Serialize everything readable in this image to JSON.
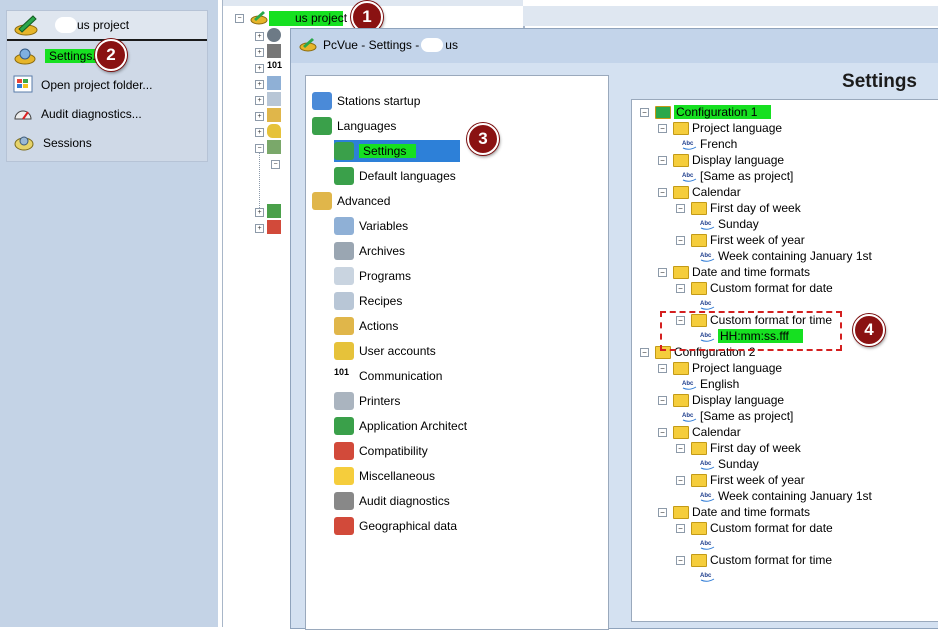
{
  "left_menu": {
    "title_prefix": "",
    "title_suffix": "us project",
    "items": [
      {
        "label": "Settings...",
        "icon": "settings-icon",
        "highlighted": true
      },
      {
        "label": "Open project folder...",
        "icon": "windows-folder-icon"
      },
      {
        "label": "Audit diagnostics...",
        "icon": "gauge-icon"
      },
      {
        "label": "Sessions",
        "icon": "sessions-icon"
      }
    ]
  },
  "project_tree": {
    "root_label": "us project"
  },
  "dialog": {
    "title_prefix": "PcVue - Settings - ",
    "title_suffix": "us",
    "nav": [
      {
        "label": "Stations startup",
        "icon": "stations-icon",
        "level": 0
      },
      {
        "label": "Languages",
        "icon": "languages-icon",
        "level": 0
      },
      {
        "label": "Settings",
        "icon": "globe-icon",
        "level": 1,
        "selected": true
      },
      {
        "label": "Default languages",
        "icon": "globe-icon",
        "level": 1
      },
      {
        "label": "Advanced",
        "icon": "advanced-icon",
        "level": 0
      },
      {
        "label": "Variables",
        "icon": "variables-icon",
        "level": 1
      },
      {
        "label": "Archives",
        "icon": "archives-icon",
        "level": 1
      },
      {
        "label": "Programs",
        "icon": "programs-icon",
        "level": 1
      },
      {
        "label": "Recipes",
        "icon": "recipes-icon",
        "level": 1
      },
      {
        "label": "Actions",
        "icon": "actions-icon",
        "level": 1
      },
      {
        "label": "User accounts",
        "icon": "key-icon",
        "level": 1
      },
      {
        "label": "Communication",
        "icon": "communication-icon",
        "level": 1
      },
      {
        "label": "Printers",
        "icon": "printer-icon",
        "level": 1
      },
      {
        "label": "Application Architect",
        "icon": "architect-icon",
        "level": 1
      },
      {
        "label": "Compatibility",
        "icon": "compatibility-icon",
        "level": 1
      },
      {
        "label": "Miscellaneous",
        "icon": "folder-icon",
        "level": 1
      },
      {
        "label": "Audit diagnostics",
        "icon": "gauge-icon",
        "level": 1
      },
      {
        "label": "Geographical data",
        "icon": "house-icon",
        "level": 1
      }
    ],
    "settings_title": "Settings",
    "tree": [
      {
        "label": "Configuration 1",
        "type": "root",
        "level": 0,
        "highlighted": true
      },
      {
        "label": "Project language",
        "type": "folder",
        "level": 1
      },
      {
        "label": "French",
        "type": "value",
        "level": 2
      },
      {
        "label": "Display language",
        "type": "folder",
        "level": 1
      },
      {
        "label": "[Same as project]",
        "type": "value",
        "level": 2
      },
      {
        "label": "Calendar",
        "type": "folder",
        "level": 1
      },
      {
        "label": "First day of week",
        "type": "folder",
        "level": 2
      },
      {
        "label": "Sunday",
        "type": "value",
        "level": 3
      },
      {
        "label": "First week of year",
        "type": "folder",
        "level": 2
      },
      {
        "label": "Week containing January 1st",
        "type": "value",
        "level": 3
      },
      {
        "label": "Date and time formats",
        "type": "folder",
        "level": 1
      },
      {
        "label": "Custom format for date",
        "type": "folder",
        "level": 2
      },
      {
        "label": "",
        "type": "value",
        "level": 3
      },
      {
        "label": "Custom format for time",
        "type": "folder",
        "level": 2
      },
      {
        "label": "HH:mm:ss.fff",
        "type": "value",
        "level": 3,
        "highlighted": true
      },
      {
        "label": "Configuration 2",
        "type": "root",
        "level": 0
      },
      {
        "label": "Project language",
        "type": "folder",
        "level": 1
      },
      {
        "label": "English",
        "type": "value",
        "level": 2
      },
      {
        "label": "Display language",
        "type": "folder",
        "level": 1
      },
      {
        "label": "[Same as project]",
        "type": "value",
        "level": 2
      },
      {
        "label": "Calendar",
        "type": "folder",
        "level": 1
      },
      {
        "label": "First day of week",
        "type": "folder",
        "level": 2
      },
      {
        "label": "Sunday",
        "type": "value",
        "level": 3
      },
      {
        "label": "First week of year",
        "type": "folder",
        "level": 2
      },
      {
        "label": "Week containing January 1st",
        "type": "value",
        "level": 3
      },
      {
        "label": "Date and time formats",
        "type": "folder",
        "level": 1
      },
      {
        "label": "Custom format for date",
        "type": "folder",
        "level": 2
      },
      {
        "label": "",
        "type": "value",
        "level": 3
      },
      {
        "label": "Custom format for time",
        "type": "folder",
        "level": 2
      },
      {
        "label": "",
        "type": "value",
        "level": 3
      }
    ]
  },
  "annotations": [
    "1",
    "2",
    "3",
    "4"
  ],
  "colors": {
    "highlight": "#16e021",
    "selection": "#2d80d8",
    "badge": "#8a1212",
    "callout": "#d42020"
  }
}
